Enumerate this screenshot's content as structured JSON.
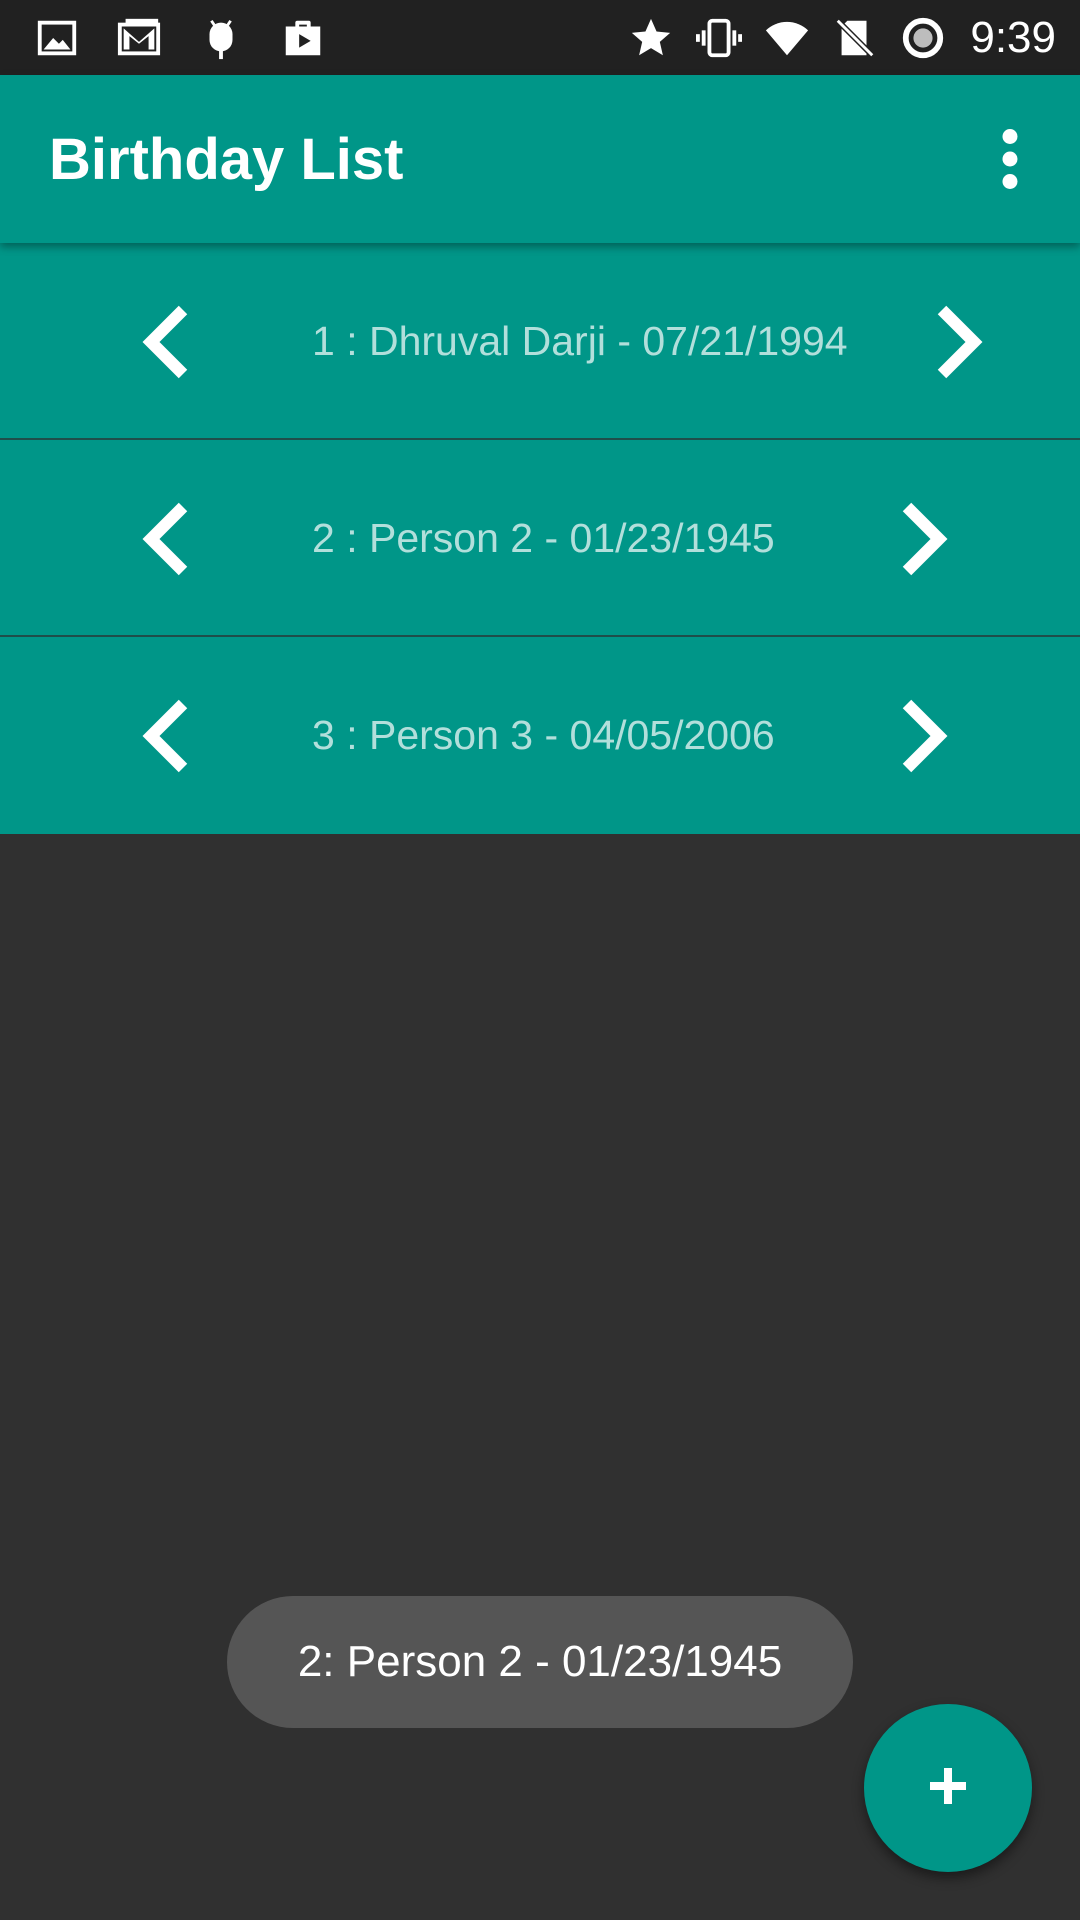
{
  "status_bar": {
    "time": "9:39",
    "left_icons": [
      "image-icon",
      "gmail-icon",
      "android-debug-icon",
      "play-store-icon"
    ],
    "right_icons": [
      "star-icon",
      "vibrate-icon",
      "wifi-icon",
      "no-sim-icon",
      "battery-saver-icon"
    ]
  },
  "app_bar": {
    "title": "Birthday List",
    "overflow_icon": "more-vert-icon"
  },
  "birthday_list": {
    "items": [
      {
        "label": "1 : Dhruval Darji - 07/21/1994"
      },
      {
        "label": "2 : Person 2 - 01/23/1945"
      },
      {
        "label": "3 : Person 3 - 04/05/2006"
      }
    ],
    "prev_icon": "chevron-left-icon",
    "next_icon": "chevron-right-icon"
  },
  "toast": {
    "message": "2: Person 2 - 01/23/1945"
  },
  "fab": {
    "icon": "plus-icon"
  },
  "colors": {
    "primary": "#009688",
    "status_bar": "#212121",
    "background": "#303030",
    "row_text": "#b2dfdb",
    "toast_bg": "#555555"
  }
}
